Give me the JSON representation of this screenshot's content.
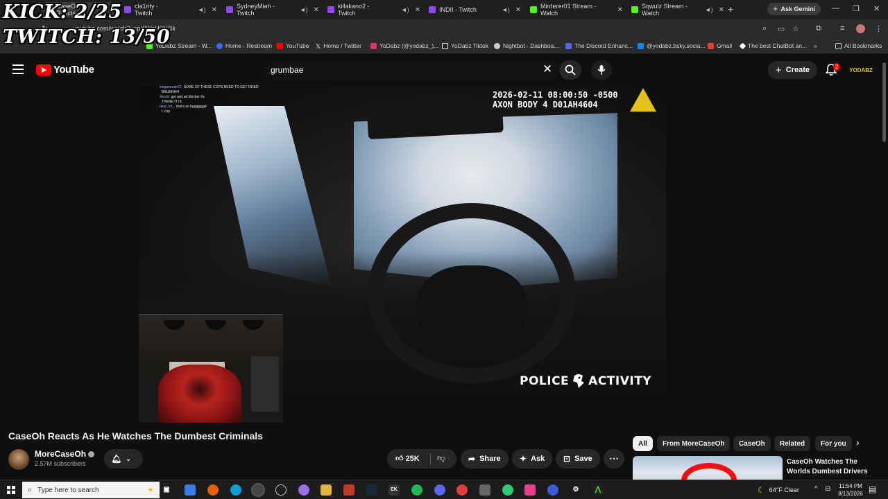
{
  "overlay": {
    "kick": "KICK: 2/25",
    "twitch": "TWITCH: 13/50"
  },
  "tabs": [
    {
      "label": "CaseOh Reacts...",
      "color": "#ff0000"
    },
    {
      "label": "cla1rity - Twitch",
      "color": "#9146ff"
    },
    {
      "label": "SydneyMiah - Twitch",
      "color": "#9146ff"
    },
    {
      "label": "killakano2 - Twitch",
      "color": "#9146ff"
    },
    {
      "label": "INDII - Twitch",
      "color": "#9146ff"
    },
    {
      "label": "Mirderer01 Stream - Watch",
      "color": "#53fc18"
    },
    {
      "label": "Sqwulz Stream - Watch",
      "color": "#53fc18"
    }
  ],
  "browser": {
    "ask_gemini": "Ask Gemini",
    "url": "youtube.com/watch?v=pXlWsH9Nj3k"
  },
  "bookmarks": [
    {
      "label": "YoDabz Stream - W...",
      "color": "#53fc18"
    },
    {
      "label": "Home - Restream",
      "color": "#3b6cf6"
    },
    {
      "label": "YouTube",
      "color": "#ff0000"
    },
    {
      "label": "Home / Twitter",
      "color": "#ffffff"
    },
    {
      "label": "YoDabz (@yodabz_)...",
      "color": "#e1306c"
    },
    {
      "label": "YoDabz Tiktok",
      "color": "#ffffff"
    },
    {
      "label": "Nightbot - Dashboa...",
      "color": "#cccccc"
    },
    {
      "label": "The Discord Enhanc...",
      "color": "#5865f2"
    },
    {
      "label": "@yodabz.bsky.socia...",
      "color": "#1185fe"
    },
    {
      "label": "Gmail",
      "color": "#ea4335"
    },
    {
      "label": "The best ChatBot an...",
      "color": "#ffffff"
    },
    {
      "label": "All Bookmarks",
      "color": "#cccccc"
    }
  ],
  "youtube": {
    "logo_text": "YouTube",
    "search_query": "grumbae",
    "create_label": "Create",
    "notif_count": "2",
    "avatar_text": "YODABZ"
  },
  "video": {
    "bodycam_line1": "2026-02-11 08:00:50 -0500",
    "bodycam_line2": "AXON BODY 4 D01AH4604",
    "watermark_left": "POLICE",
    "watermark_right": "ACTIVITY",
    "chat": [
      {
        "user": "kingamurah72",
        "msg": "SOME OF THESE COPS NEED TO GET FIRED"
      },
      {
        "user": "",
        "msg": "BRUHHHH"
      },
      {
        "user": "Alexld",
        "msg": "get and ad blocker #a"
      },
      {
        "user": "",
        "msg": "THERE IT IS"
      },
      {
        "user": "tater_tot_",
        "msg": "that's so fuggggggd"
      },
      {
        "user": "",
        "msg": "L cop"
      }
    ]
  },
  "details": {
    "title": "CaseOh Reacts As He Watches The Dumbest Criminals",
    "channel": "MoreCaseOh",
    "subscribers": "2.57M subscribers",
    "likes": "25K",
    "share": "Share",
    "ask": "Ask",
    "save": "Save"
  },
  "chips": [
    "All",
    "From MoreCaseOh",
    "CaseOh",
    "Related",
    "For you"
  ],
  "recommendation": {
    "title": "CaseOh Watches The Worlds Dumbest Drivers"
  },
  "taskbar": {
    "search_placeholder": "Type here to search",
    "weather": "64°F  Clear",
    "time": "11:54 PM",
    "date": "8/13/2026"
  }
}
